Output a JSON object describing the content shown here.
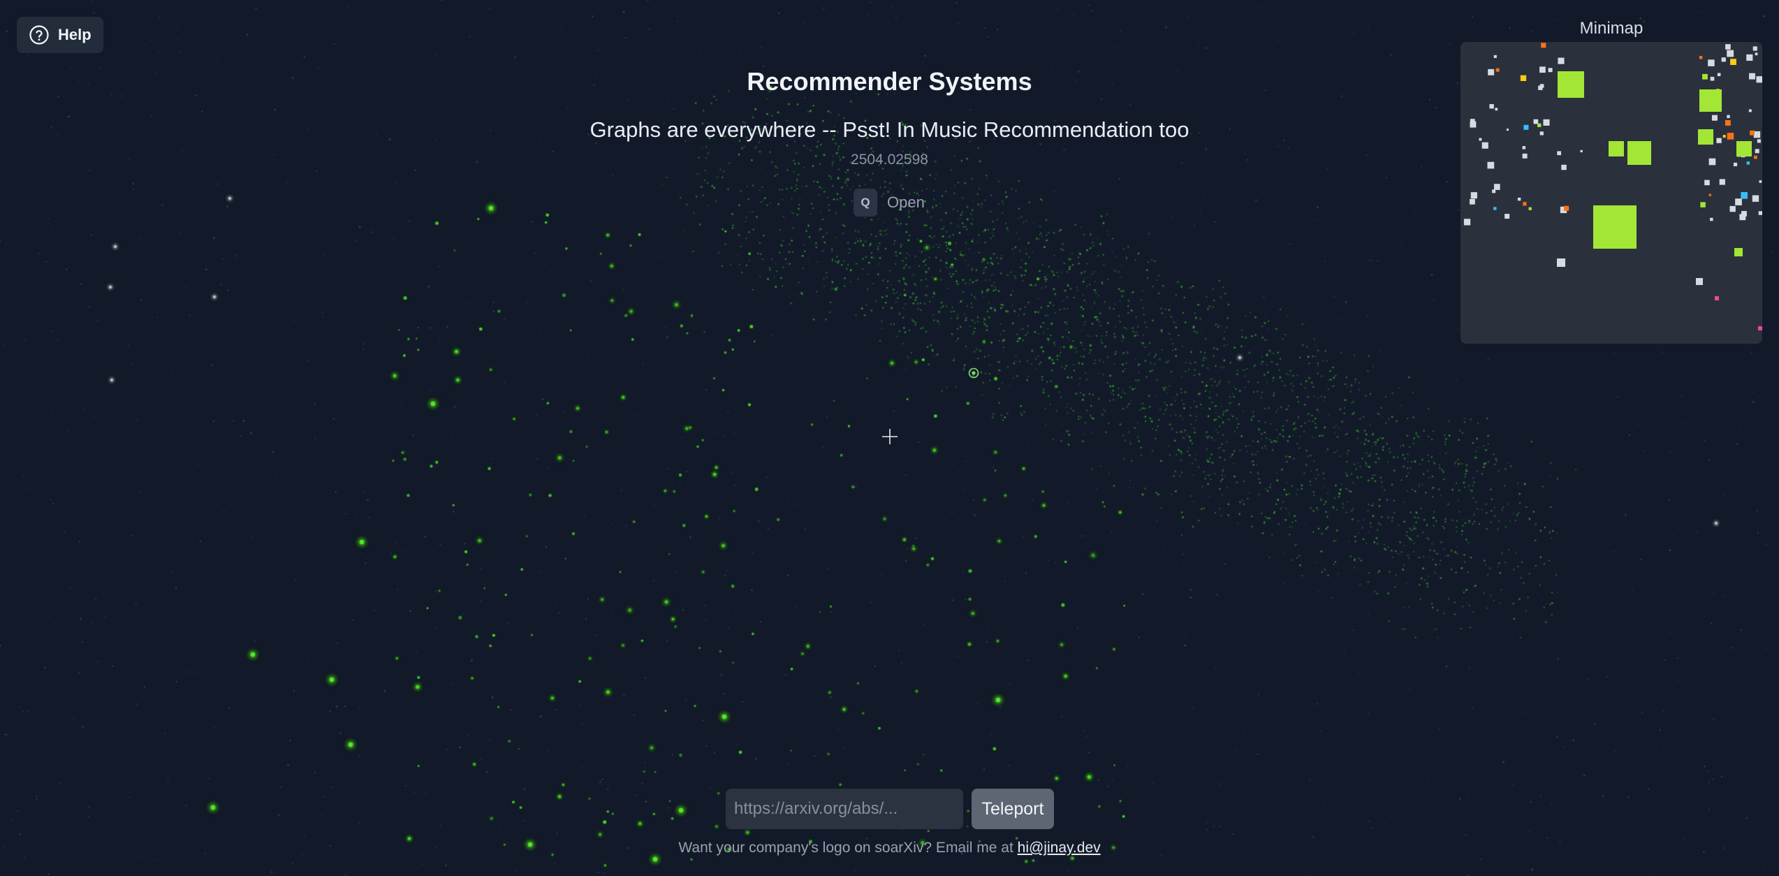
{
  "help": {
    "label": "Help",
    "icon": "help-circle-icon"
  },
  "paper": {
    "category": "Recommender Systems",
    "title": "Graphs are everywhere -- Psst! In Music Recommendation too",
    "arxiv_id": "2504.02598"
  },
  "open_action": {
    "key": "Q",
    "label": "Open"
  },
  "minimap": {
    "title": "Minimap"
  },
  "teleport": {
    "placeholder": "https://arxiv.org/abs/...",
    "button_label": "Teleport"
  },
  "footer": {
    "text": "Want your company's logo on soarXiv? Email me at ",
    "email": "hi@jinay.dev"
  },
  "colors": {
    "background": "#121a2a",
    "highlight_green": "#a3e635",
    "star_green": "#4ade20",
    "minimap_bg": "#2a313d",
    "minimap_orange": "#f97316",
    "minimap_blue": "#38bdf8",
    "minimap_pink": "#ec4899",
    "minimap_yellow": "#facc15"
  }
}
